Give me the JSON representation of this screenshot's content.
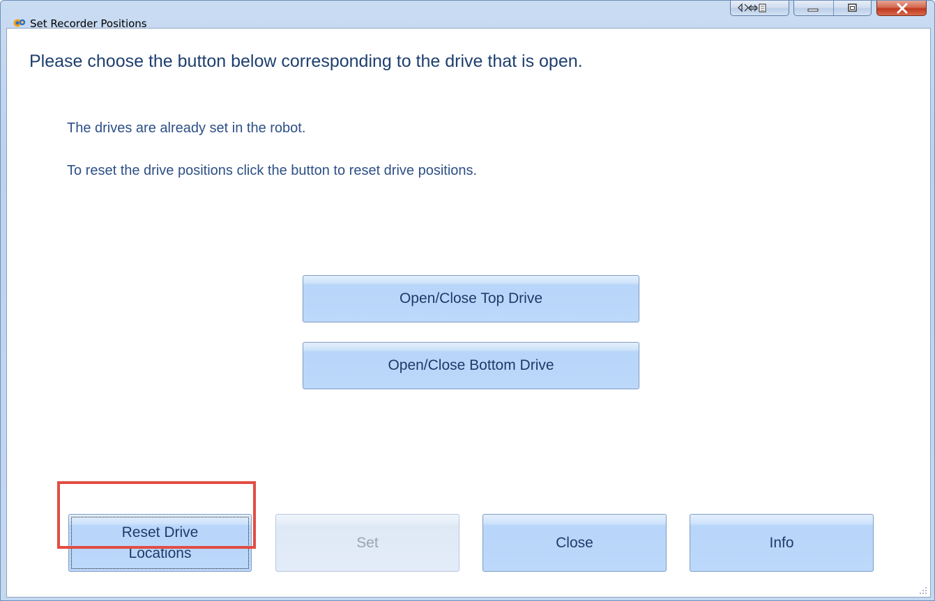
{
  "window": {
    "title": "Set Recorder Positions"
  },
  "content": {
    "heading": "Please choose the button below corresponding to the drive that is open.",
    "info_lines": [
      "The drives are already set in the robot.",
      "To reset the drive positions click the button to reset drive positions."
    ]
  },
  "drive_buttons": {
    "top": "Open/Close Top Drive",
    "bottom": "Open/Close Bottom Drive"
  },
  "footer_buttons": {
    "reset_line1": "Reset Drive",
    "reset_line2": "Locations",
    "set": "Set",
    "close": "Close",
    "info": "Info"
  },
  "icons": {
    "app": "recorder-app-icon",
    "caption": [
      "back-forward-icon",
      "minimize-icon",
      "maximize-icon",
      "close-icon"
    ],
    "resize": "resize-grip-icon"
  },
  "colors": {
    "heading": "#1e3f6e",
    "text": "#2c4f86",
    "button_fill": "#bcd8fb",
    "highlight": "#e24d43",
    "close_button": "#c0391f"
  }
}
